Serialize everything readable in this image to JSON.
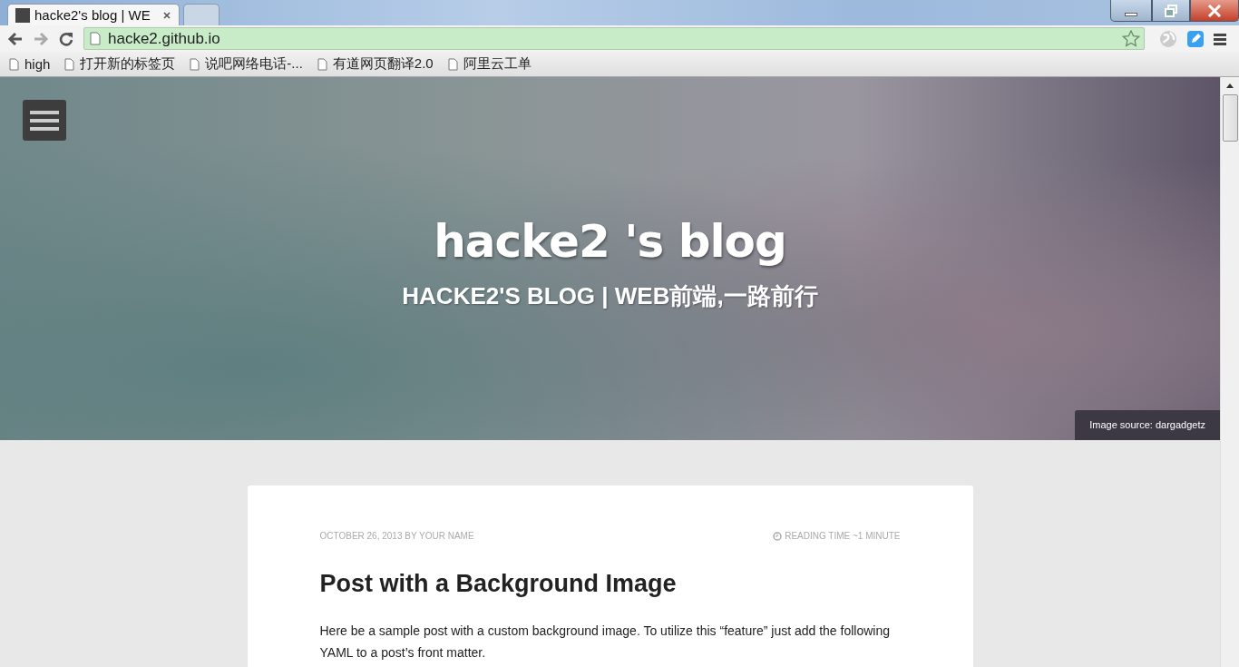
{
  "tabs": [
    {
      "label": "hacke2's blog | WE",
      "selected": true
    },
    {
      "selected": false
    }
  ],
  "address_bar": {
    "value": "hacke2.github.io"
  },
  "bookmarks": [
    "high",
    "打开新的标签页",
    "说吧网络电话-...",
    "有道网页翻译2.0",
    "阿里云工单"
  ],
  "hero": {
    "title": "hacke2 's blog",
    "subtitle": "HACKE2'S BLOG | WEB前端,一路前行",
    "image_credit": "Image source: dargadgetz"
  },
  "post": {
    "meta": "OCTOBER 26, 2013 BY YOUR NAME",
    "reading_time": "READING TIME ~1 MINUTE",
    "title": "Post with a Background Image",
    "body": "Here be a sample post with a custom background image. To utilize this “feature” just add the following YAML to a post’s front matter."
  }
}
